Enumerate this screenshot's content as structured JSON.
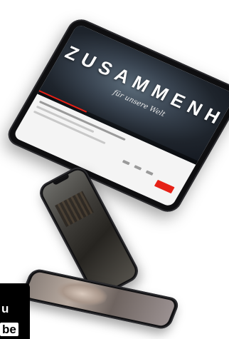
{
  "tablet": {
    "video_title": "ZUSAMMENHALT",
    "video_subtitle": "für unsere Welt"
  },
  "corner_badge": {
    "line1": "u",
    "line2": "be"
  }
}
